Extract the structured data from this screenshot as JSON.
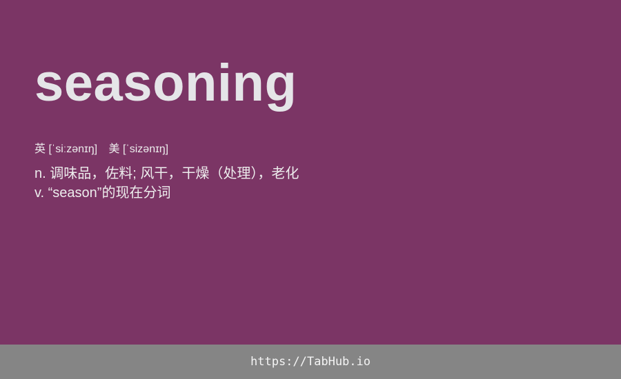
{
  "theme": {
    "background": "#7b3565",
    "footer_background": "#858585",
    "text": "#e6e6e6"
  },
  "entry": {
    "word": "seasoning",
    "phonetics": {
      "uk": "英 [ˈsiːzənɪŋ]",
      "us": "美 [ˈsizənɪŋ]"
    },
    "definitions": [
      "n. 调味品，佐料; 风干，干燥（处理），老化",
      "v. “season”的现在分词"
    ]
  },
  "footer": {
    "link": "https://TabHub.io"
  }
}
